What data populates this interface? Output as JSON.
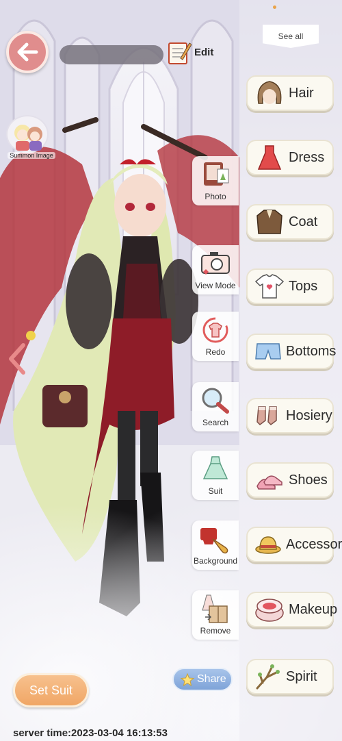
{
  "header": {
    "edit_label": "Edit",
    "summon_label": "Summon Image"
  },
  "tools": [
    {
      "label": "Photo",
      "icon": "photo-album-icon"
    },
    {
      "label": "View Mode",
      "icon": "camera-icon"
    },
    {
      "label": "Redo",
      "icon": "redo-shirt-icon"
    },
    {
      "label": "Search",
      "icon": "magnifier-icon"
    },
    {
      "label": "Suit",
      "icon": "dress-suit-icon"
    },
    {
      "label": "Background",
      "icon": "paint-brush-icon"
    },
    {
      "label": "Remove",
      "icon": "box-remove-icon"
    }
  ],
  "panel": {
    "see_all": "See all",
    "categories": [
      {
        "label": "Hair",
        "icon": "hair-icon"
      },
      {
        "label": "Dress",
        "icon": "dress-icon"
      },
      {
        "label": "Coat",
        "icon": "coat-icon"
      },
      {
        "label": "Tops",
        "icon": "tshirt-icon"
      },
      {
        "label": "Bottoms",
        "icon": "shorts-icon"
      },
      {
        "label": "Hosiery",
        "icon": "socks-icon"
      },
      {
        "label": "Shoes",
        "icon": "heels-icon"
      },
      {
        "label": "Accessory",
        "icon": "hat-icon"
      },
      {
        "label": "Makeup",
        "icon": "compact-icon"
      },
      {
        "label": "Spirit",
        "icon": "branch-icon"
      }
    ]
  },
  "footer": {
    "set_suit": "Set Suit",
    "share": "Share",
    "server_time": "server time:2023-03-04 16:13:53"
  },
  "colors": {
    "back_button": "#e08d8d",
    "set_suit": "#f0a665",
    "share": "#7ea3d8",
    "dress_red": "#8e1c28",
    "hair_green": "#dfe8b0"
  }
}
